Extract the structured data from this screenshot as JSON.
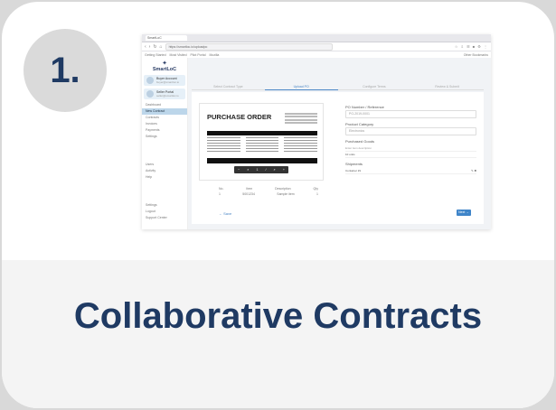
{
  "card": {
    "step_number": "1.",
    "title": "Collaborative Contracts"
  },
  "screenshot": {
    "browser": {
      "tab_label": "SmartLoC",
      "url": "https://smartloc.io/uploadpo",
      "bookmarks": [
        "Getting Started",
        "Most Visited",
        "Pilot Portal",
        "Mozilla"
      ],
      "other_bookmarks": "Other Bookmarks"
    },
    "app": {
      "logo_text": "SmartLoC",
      "user_cards": [
        {
          "name": "Buyer Account",
          "sub": "buyer@smartloc.io"
        },
        {
          "name": "Seller Portal",
          "sub": "seller@smartloc.io"
        }
      ],
      "nav_items": [
        "Dashboard",
        "New Contract",
        "Contracts",
        "Invoices",
        "Payments",
        "Settings"
      ],
      "nav_lower": [
        "Users",
        "Activity",
        "Help"
      ],
      "nav_bottom": [
        "Settings",
        "Logout",
        "Support Center"
      ],
      "step_tabs": [
        "Select Contract Type",
        "Upload PO",
        "Configure Terms",
        "Review & Submit"
      ],
      "document_title": "PURCHASE ORDER",
      "zoom_controls": [
        "−",
        "⌕",
        "1",
        "/",
        "⌕",
        "+"
      ],
      "fields": {
        "po_number_label": "PO Number / Reference",
        "po_number_value": "PO-2019-0001",
        "category_label": "Product Category",
        "category_value": "Electronics",
        "items_label": "Purchased Goods",
        "items_hint": "Enter item description",
        "items_row": "10 units",
        "shipment_label": "Shipments",
        "shipment_row": "Container #1"
      },
      "lower_table": {
        "headers": [
          "No.",
          "Item",
          "Description",
          "Qty"
        ],
        "row": [
          "1",
          "5001234",
          "Sample item",
          "1"
        ]
      },
      "save_label": "← Save",
      "next_label": "Next →"
    }
  }
}
